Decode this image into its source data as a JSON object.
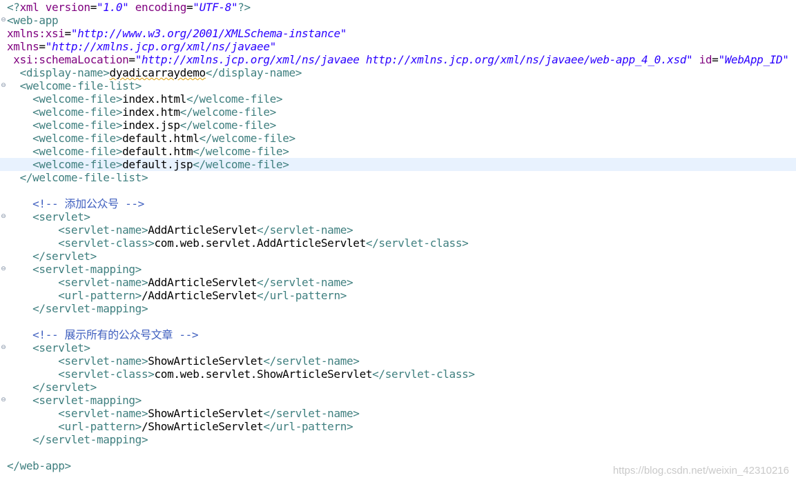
{
  "editor": {
    "language": "xml",
    "colors": {
      "tag": "#3f7f7f",
      "attribute": "#7f007f",
      "value": "#2a00ff",
      "text": "#000000",
      "comment": "#3f5fbf",
      "current_line": "#e8f2fe",
      "fold_marker": "#7f8ea3"
    },
    "icons": {
      "fold_marker": "fold-collapse-icon"
    },
    "lines": [
      {
        "fold": false,
        "highlight": false,
        "tokens": [
          {
            "t": "tag",
            "v": "<?"
          },
          {
            "t": "attr",
            "v": "xml "
          },
          {
            "t": "attr",
            "v": "version"
          },
          {
            "t": "text",
            "v": "="
          },
          {
            "t": "val",
            "v": "\"1.0\""
          },
          {
            "t": "text",
            "v": " "
          },
          {
            "t": "attr",
            "v": "encoding"
          },
          {
            "t": "text",
            "v": "="
          },
          {
            "t": "val",
            "v": "\"UTF-8\""
          },
          {
            "t": "tag",
            "v": "?>"
          }
        ]
      },
      {
        "fold": true,
        "highlight": false,
        "tokens": [
          {
            "t": "tag",
            "v": "<web-app"
          }
        ]
      },
      {
        "fold": false,
        "highlight": false,
        "tokens": [
          {
            "t": "attr",
            "v": "xmlns:xsi"
          },
          {
            "t": "text",
            "v": "="
          },
          {
            "t": "val",
            "v": "\"http://www.w3.org/2001/XMLSchema-instance\""
          }
        ]
      },
      {
        "fold": false,
        "highlight": false,
        "tokens": [
          {
            "t": "attr",
            "v": "xmlns"
          },
          {
            "t": "text",
            "v": "="
          },
          {
            "t": "val",
            "v": "\"http://xmlns.jcp.org/xml/ns/javaee\""
          }
        ]
      },
      {
        "fold": false,
        "highlight": false,
        "tokens": [
          {
            "t": "text",
            "v": " "
          },
          {
            "t": "attr",
            "v": "xsi:schemaLocation"
          },
          {
            "t": "text",
            "v": "="
          },
          {
            "t": "val",
            "v": "\"http://xmlns.jcp.org/xml/ns/javaee http://xmlns.jcp.org/xml/ns/javaee/web-app_4_0.xsd\""
          },
          {
            "t": "text",
            "v": " "
          },
          {
            "t": "attr",
            "v": "id"
          },
          {
            "t": "text",
            "v": "="
          },
          {
            "t": "val",
            "v": "\"WebApp_ID\""
          }
        ]
      },
      {
        "fold": false,
        "highlight": false,
        "tokens": [
          {
            "t": "text",
            "v": "  "
          },
          {
            "t": "tag",
            "v": "<display-name>"
          },
          {
            "t": "squiggle",
            "v": "dyadicarraydemo"
          },
          {
            "t": "tag",
            "v": "</display-name>"
          }
        ]
      },
      {
        "fold": true,
        "highlight": false,
        "tokens": [
          {
            "t": "text",
            "v": "  "
          },
          {
            "t": "tag",
            "v": "<welcome-file-list>"
          }
        ]
      },
      {
        "fold": false,
        "highlight": false,
        "tokens": [
          {
            "t": "text",
            "v": "    "
          },
          {
            "t": "tag",
            "v": "<welcome-file>"
          },
          {
            "t": "text",
            "v": "index.html"
          },
          {
            "t": "tag",
            "v": "</welcome-file>"
          }
        ]
      },
      {
        "fold": false,
        "highlight": false,
        "tokens": [
          {
            "t": "text",
            "v": "    "
          },
          {
            "t": "tag",
            "v": "<welcome-file>"
          },
          {
            "t": "text",
            "v": "index.htm"
          },
          {
            "t": "tag",
            "v": "</welcome-file>"
          }
        ]
      },
      {
        "fold": false,
        "highlight": false,
        "tokens": [
          {
            "t": "text",
            "v": "    "
          },
          {
            "t": "tag",
            "v": "<welcome-file>"
          },
          {
            "t": "text",
            "v": "index.jsp"
          },
          {
            "t": "tag",
            "v": "</welcome-file>"
          }
        ]
      },
      {
        "fold": false,
        "highlight": false,
        "tokens": [
          {
            "t": "text",
            "v": "    "
          },
          {
            "t": "tag",
            "v": "<welcome-file>"
          },
          {
            "t": "text",
            "v": "default.html"
          },
          {
            "t": "tag",
            "v": "</welcome-file>"
          }
        ]
      },
      {
        "fold": false,
        "highlight": false,
        "tokens": [
          {
            "t": "text",
            "v": "    "
          },
          {
            "t": "tag",
            "v": "<welcome-file>"
          },
          {
            "t": "text",
            "v": "default.htm"
          },
          {
            "t": "tag",
            "v": "</welcome-file>"
          }
        ]
      },
      {
        "fold": false,
        "highlight": true,
        "tokens": [
          {
            "t": "text",
            "v": "    "
          },
          {
            "t": "tag",
            "v": "<welcome-file>"
          },
          {
            "t": "text",
            "v": "default.jsp"
          },
          {
            "t": "tag",
            "v": "</welcome-file>"
          }
        ]
      },
      {
        "fold": false,
        "highlight": false,
        "tokens": [
          {
            "t": "text",
            "v": "  "
          },
          {
            "t": "tag",
            "v": "</welcome-file-list>"
          }
        ]
      },
      {
        "fold": false,
        "highlight": false,
        "tokens": []
      },
      {
        "fold": false,
        "highlight": false,
        "tokens": [
          {
            "t": "text",
            "v": "    "
          },
          {
            "t": "comment",
            "v": "<!-- 添加公众号 -->"
          }
        ]
      },
      {
        "fold": true,
        "highlight": false,
        "tokens": [
          {
            "t": "text",
            "v": "    "
          },
          {
            "t": "tag",
            "v": "<servlet>"
          }
        ]
      },
      {
        "fold": false,
        "highlight": false,
        "tokens": [
          {
            "t": "text",
            "v": "        "
          },
          {
            "t": "tag",
            "v": "<servlet-name>"
          },
          {
            "t": "text",
            "v": "AddArticleServlet"
          },
          {
            "t": "tag",
            "v": "</servlet-name>"
          }
        ]
      },
      {
        "fold": false,
        "highlight": false,
        "tokens": [
          {
            "t": "text",
            "v": "        "
          },
          {
            "t": "tag",
            "v": "<servlet-class>"
          },
          {
            "t": "text",
            "v": "com.web.servlet.AddArticleServlet"
          },
          {
            "t": "tag",
            "v": "</servlet-class>"
          }
        ]
      },
      {
        "fold": false,
        "highlight": false,
        "tokens": [
          {
            "t": "text",
            "v": "    "
          },
          {
            "t": "tag",
            "v": "</servlet>"
          }
        ]
      },
      {
        "fold": true,
        "highlight": false,
        "tokens": [
          {
            "t": "text",
            "v": "    "
          },
          {
            "t": "tag",
            "v": "<servlet-mapping>"
          }
        ]
      },
      {
        "fold": false,
        "highlight": false,
        "tokens": [
          {
            "t": "text",
            "v": "        "
          },
          {
            "t": "tag",
            "v": "<servlet-name>"
          },
          {
            "t": "text",
            "v": "AddArticleServlet"
          },
          {
            "t": "tag",
            "v": "</servlet-name>"
          }
        ]
      },
      {
        "fold": false,
        "highlight": false,
        "tokens": [
          {
            "t": "text",
            "v": "        "
          },
          {
            "t": "tag",
            "v": "<url-pattern>"
          },
          {
            "t": "text",
            "v": "/AddArticleServlet"
          },
          {
            "t": "tag",
            "v": "</url-pattern>"
          }
        ]
      },
      {
        "fold": false,
        "highlight": false,
        "tokens": [
          {
            "t": "text",
            "v": "    "
          },
          {
            "t": "tag",
            "v": "</servlet-mapping>"
          }
        ]
      },
      {
        "fold": false,
        "highlight": false,
        "tokens": []
      },
      {
        "fold": false,
        "highlight": false,
        "tokens": [
          {
            "t": "text",
            "v": "    "
          },
          {
            "t": "comment",
            "v": "<!-- 展示所有的公众号文章 -->"
          }
        ]
      },
      {
        "fold": true,
        "highlight": false,
        "tokens": [
          {
            "t": "text",
            "v": "    "
          },
          {
            "t": "tag",
            "v": "<servlet>"
          }
        ]
      },
      {
        "fold": false,
        "highlight": false,
        "tokens": [
          {
            "t": "text",
            "v": "        "
          },
          {
            "t": "tag",
            "v": "<servlet-name>"
          },
          {
            "t": "text",
            "v": "ShowArticleServlet"
          },
          {
            "t": "tag",
            "v": "</servlet-name>"
          }
        ]
      },
      {
        "fold": false,
        "highlight": false,
        "tokens": [
          {
            "t": "text",
            "v": "        "
          },
          {
            "t": "tag",
            "v": "<servlet-class>"
          },
          {
            "t": "text",
            "v": "com.web.servlet.ShowArticleServlet"
          },
          {
            "t": "tag",
            "v": "</servlet-class>"
          }
        ]
      },
      {
        "fold": false,
        "highlight": false,
        "tokens": [
          {
            "t": "text",
            "v": "    "
          },
          {
            "t": "tag",
            "v": "</servlet>"
          }
        ]
      },
      {
        "fold": true,
        "highlight": false,
        "tokens": [
          {
            "t": "text",
            "v": "    "
          },
          {
            "t": "tag",
            "v": "<servlet-mapping>"
          }
        ]
      },
      {
        "fold": false,
        "highlight": false,
        "tokens": [
          {
            "t": "text",
            "v": "        "
          },
          {
            "t": "tag",
            "v": "<servlet-name>"
          },
          {
            "t": "text",
            "v": "ShowArticleServlet"
          },
          {
            "t": "tag",
            "v": "</servlet-name>"
          }
        ]
      },
      {
        "fold": false,
        "highlight": false,
        "tokens": [
          {
            "t": "text",
            "v": "        "
          },
          {
            "t": "tag",
            "v": "<url-pattern>"
          },
          {
            "t": "text",
            "v": "/ShowArticleServlet"
          },
          {
            "t": "tag",
            "v": "</url-pattern>"
          }
        ]
      },
      {
        "fold": false,
        "highlight": false,
        "tokens": [
          {
            "t": "text",
            "v": "    "
          },
          {
            "t": "tag",
            "v": "</servlet-mapping>"
          }
        ]
      },
      {
        "fold": false,
        "highlight": false,
        "tokens": []
      },
      {
        "fold": false,
        "highlight": false,
        "tokens": [
          {
            "t": "tag",
            "v": "</web-app>"
          }
        ]
      }
    ]
  },
  "watermark": {
    "text": "https://blog.csdn.net/weixin_42310216"
  }
}
